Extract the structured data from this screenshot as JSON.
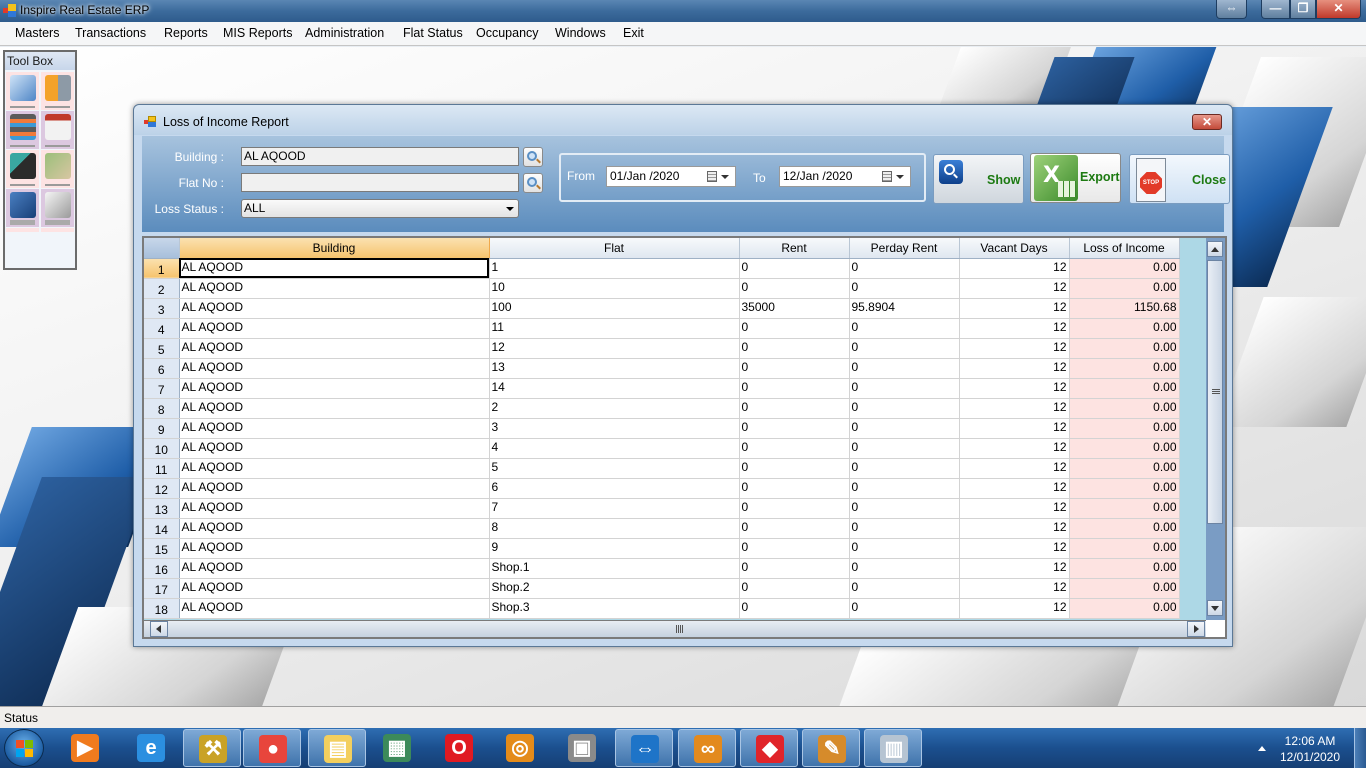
{
  "window": {
    "title": "Inspire Real Estate ERP",
    "controls": {
      "resize": "⇔",
      "minimize": "—",
      "maximize": "❐",
      "close": "✕"
    }
  },
  "menu": [
    {
      "label": "Masters"
    },
    {
      "label": "Transactions"
    },
    {
      "label": "Reports"
    },
    {
      "label": "MIS Reports"
    },
    {
      "label": "Administration"
    },
    {
      "label": "Flat Status"
    },
    {
      "label": "Occupancy"
    },
    {
      "label": "Windows"
    },
    {
      "label": "Exit"
    }
  ],
  "toolbox": {
    "title": "Tool Box",
    "items": [
      {
        "icon": "edit-document-icon"
      },
      {
        "icon": "buildings-icon"
      },
      {
        "icon": "stacked-layers-icon"
      },
      {
        "icon": "upload-calendar-icon"
      },
      {
        "icon": "books-chart-icon"
      },
      {
        "icon": "money-icon"
      },
      {
        "icon": "notebook-pencil-icon"
      },
      {
        "icon": "documents-stack-icon"
      }
    ]
  },
  "dialog": {
    "title": "Loss of Income Report",
    "close": "✕",
    "filters": {
      "building_label": "Building :",
      "building_value": "AL AQOOD",
      "flat_label": "Flat No :",
      "flat_value": "",
      "loss_status_label": "Loss Status :",
      "loss_status_value": "ALL"
    },
    "dates": {
      "from_label": "From",
      "from_value": "01/Jan /2020",
      "to_label": "To",
      "to_value": "12/Jan /2020"
    },
    "buttons": {
      "show": "Show",
      "export": "Export",
      "close": "Close",
      "stop_text": "STOP"
    },
    "grid": {
      "columns": [
        "Building",
        "Flat",
        "Rent",
        "Perday Rent",
        "Vacant Days",
        "Loss of Income"
      ],
      "rows": [
        {
          "n": "1",
          "building": "AL AQOOD",
          "flat": "1",
          "rent": "0",
          "perday": "0",
          "vacant": "12",
          "loss": "0.00"
        },
        {
          "n": "2",
          "building": "AL AQOOD",
          "flat": "10",
          "rent": "0",
          "perday": "0",
          "vacant": "12",
          "loss": "0.00"
        },
        {
          "n": "3",
          "building": "AL AQOOD",
          "flat": "100",
          "rent": "35000",
          "perday": "95.8904",
          "vacant": "12",
          "loss": "1150.68"
        },
        {
          "n": "4",
          "building": "AL AQOOD",
          "flat": "11",
          "rent": "0",
          "perday": "0",
          "vacant": "12",
          "loss": "0.00"
        },
        {
          "n": "5",
          "building": "AL AQOOD",
          "flat": "12",
          "rent": "0",
          "perday": "0",
          "vacant": "12",
          "loss": "0.00"
        },
        {
          "n": "6",
          "building": "AL AQOOD",
          "flat": "13",
          "rent": "0",
          "perday": "0",
          "vacant": "12",
          "loss": "0.00"
        },
        {
          "n": "7",
          "building": "AL AQOOD",
          "flat": "14",
          "rent": "0",
          "perday": "0",
          "vacant": "12",
          "loss": "0.00"
        },
        {
          "n": "8",
          "building": "AL AQOOD",
          "flat": "2",
          "rent": "0",
          "perday": "0",
          "vacant": "12",
          "loss": "0.00"
        },
        {
          "n": "9",
          "building": "AL AQOOD",
          "flat": "3",
          "rent": "0",
          "perday": "0",
          "vacant": "12",
          "loss": "0.00"
        },
        {
          "n": "10",
          "building": "AL AQOOD",
          "flat": "4",
          "rent": "0",
          "perday": "0",
          "vacant": "12",
          "loss": "0.00"
        },
        {
          "n": "11",
          "building": "AL AQOOD",
          "flat": "5",
          "rent": "0",
          "perday": "0",
          "vacant": "12",
          "loss": "0.00"
        },
        {
          "n": "12",
          "building": "AL AQOOD",
          "flat": "6",
          "rent": "0",
          "perday": "0",
          "vacant": "12",
          "loss": "0.00"
        },
        {
          "n": "13",
          "building": "AL AQOOD",
          "flat": "7",
          "rent": "0",
          "perday": "0",
          "vacant": "12",
          "loss": "0.00"
        },
        {
          "n": "14",
          "building": "AL AQOOD",
          "flat": "8",
          "rent": "0",
          "perday": "0",
          "vacant": "12",
          "loss": "0.00"
        },
        {
          "n": "15",
          "building": "AL AQOOD",
          "flat": "9",
          "rent": "0",
          "perday": "0",
          "vacant": "12",
          "loss": "0.00"
        },
        {
          "n": "16",
          "building": "AL AQOOD",
          "flat": "Shop.1",
          "rent": "0",
          "perday": "0",
          "vacant": "12",
          "loss": "0.00"
        },
        {
          "n": "17",
          "building": "AL AQOOD",
          "flat": "Shop.2",
          "rent": "0",
          "perday": "0",
          "vacant": "12",
          "loss": "0.00"
        },
        {
          "n": "18",
          "building": "AL AQOOD",
          "flat": "Shop.3",
          "rent": "0",
          "perday": "0",
          "vacant": "12",
          "loss": "0.00"
        }
      ]
    }
  },
  "statusbar": {
    "text": "Status"
  },
  "taskbar": {
    "apps": [
      {
        "name": "media-player-icon",
        "glyph": "▶",
        "color": "#f07b1e",
        "pinned": false
      },
      {
        "name": "internet-explorer-icon",
        "glyph": "e",
        "color": "#2b8fe0",
        "pinned": false
      },
      {
        "name": "database-tools-icon",
        "glyph": "⚒",
        "color": "#c9a227",
        "pinned": true
      },
      {
        "name": "chrome-icon",
        "glyph": "●",
        "color": "#e8453c",
        "pinned": true
      },
      {
        "name": "file-explorer-icon",
        "glyph": "▤",
        "color": "#f3cf5e",
        "pinned": true
      },
      {
        "name": "document-viewer-icon",
        "glyph": "▦",
        "color": "#3c8a5a",
        "pinned": false
      },
      {
        "name": "opera-icon",
        "glyph": "O",
        "color": "#e01a22",
        "pinned": false
      },
      {
        "name": "search-globe-icon",
        "glyph": "◎",
        "color": "#e48b1a",
        "pinned": false
      },
      {
        "name": "printer-icon",
        "glyph": "▣",
        "color": "#8a8a8a",
        "pinned": false
      },
      {
        "name": "teamviewer-icon",
        "glyph": "⇔",
        "color": "#1e74c8",
        "pinned": true
      },
      {
        "name": "visual-studio-icon",
        "glyph": "∞",
        "color": "#e38a1e",
        "pinned": true
      },
      {
        "name": "red-diamond-app-icon",
        "glyph": "◆",
        "color": "#e0242a",
        "pinned": true
      },
      {
        "name": "paint-icon",
        "glyph": "✎",
        "color": "#d68b2b",
        "pinned": true
      },
      {
        "name": "erp-app-icon",
        "glyph": "▥",
        "color": "#b6c4d2",
        "pinned": true
      }
    ],
    "clock_time": "12:06 AM",
    "clock_date": "12/01/2020"
  }
}
